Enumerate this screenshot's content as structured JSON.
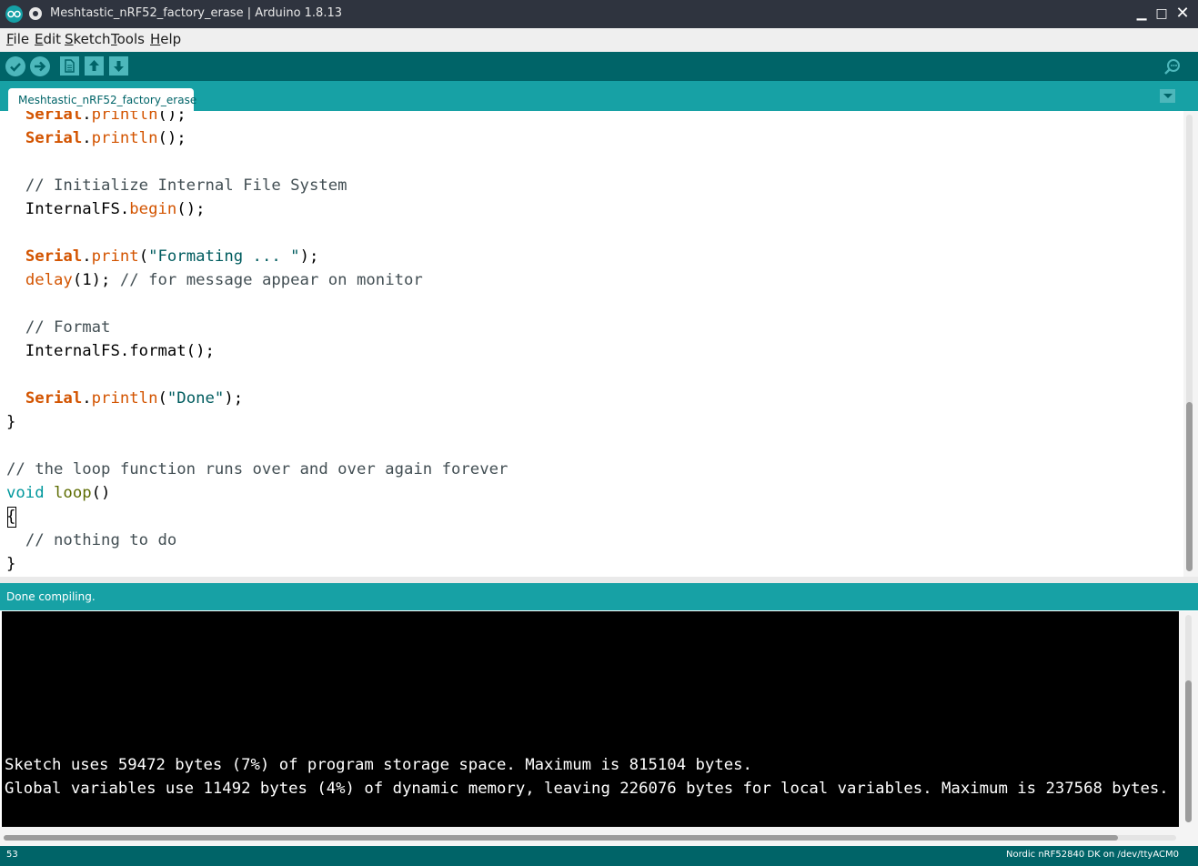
{
  "window": {
    "title": "Meshtastic_nRF52_factory_erase | Arduino 1.8.13",
    "minimize_label": "▁",
    "maximize_label": "□",
    "close_label": "✕"
  },
  "menu": [
    {
      "acc": "F",
      "rest": "ile"
    },
    {
      "acc": "E",
      "rest": "dit"
    },
    {
      "acc": "S",
      "rest": "ketch"
    },
    {
      "acc": "T",
      "rest": "ools"
    },
    {
      "acc": "H",
      "rest": "elp"
    }
  ],
  "toolbar": {
    "icons": [
      "verify-icon",
      "upload-icon",
      "new-icon",
      "open-icon",
      "save-icon",
      "serial-monitor-icon"
    ]
  },
  "tabs": {
    "active": "Meshtastic_nRF52_factory_erase"
  },
  "colors": {
    "teal_dark": "#006468",
    "teal": "#17a1a5",
    "keyword_orange": "#d35400",
    "keyword_teal": "#00979c",
    "function_olive": "#5e6d03",
    "string": "#005c5f",
    "comment": "#434f54"
  },
  "editor": {
    "lines": [
      {
        "tokens": [
          {
            "t": "  "
          },
          {
            "t": "Serial",
            "c": "kw-orange"
          },
          {
            "t": "."
          },
          {
            "t": "println",
            "c": "fn-orange"
          },
          {
            "t": "();"
          }
        ]
      },
      {
        "tokens": [
          {
            "t": "  "
          },
          {
            "t": "Serial",
            "c": "kw-orange"
          },
          {
            "t": "."
          },
          {
            "t": "println",
            "c": "fn-orange"
          },
          {
            "t": "();"
          }
        ]
      },
      {
        "tokens": []
      },
      {
        "tokens": [
          {
            "t": "  "
          },
          {
            "t": "// Initialize Internal File System",
            "c": "cmt"
          }
        ]
      },
      {
        "tokens": [
          {
            "t": "  InternalFS."
          },
          {
            "t": "begin",
            "c": "fn-orange"
          },
          {
            "t": "();"
          }
        ]
      },
      {
        "tokens": []
      },
      {
        "tokens": [
          {
            "t": "  "
          },
          {
            "t": "Serial",
            "c": "kw-orange"
          },
          {
            "t": "."
          },
          {
            "t": "print",
            "c": "fn-orange"
          },
          {
            "t": "("
          },
          {
            "t": "\"Formating ... \"",
            "c": "str"
          },
          {
            "t": ");"
          }
        ]
      },
      {
        "tokens": [
          {
            "t": "  "
          },
          {
            "t": "delay",
            "c": "fn-orange"
          },
          {
            "t": "(1); "
          },
          {
            "t": "// for message appear on monitor",
            "c": "cmt"
          }
        ]
      },
      {
        "tokens": []
      },
      {
        "tokens": [
          {
            "t": "  "
          },
          {
            "t": "// Format",
            "c": "cmt"
          }
        ]
      },
      {
        "tokens": [
          {
            "t": "  InternalFS.format();"
          }
        ]
      },
      {
        "tokens": []
      },
      {
        "tokens": [
          {
            "t": "  "
          },
          {
            "t": "Serial",
            "c": "kw-orange"
          },
          {
            "t": "."
          },
          {
            "t": "println",
            "c": "fn-orange"
          },
          {
            "t": "("
          },
          {
            "t": "\"Done\"",
            "c": "str"
          },
          {
            "t": ");"
          }
        ]
      },
      {
        "tokens": [
          {
            "t": "}"
          }
        ]
      },
      {
        "tokens": []
      },
      {
        "tokens": [
          {
            "t": "// the loop function runs over and over again forever",
            "c": "cmt"
          }
        ]
      },
      {
        "tokens": [
          {
            "t": "void",
            "c": "kw-teal"
          },
          {
            "t": " "
          },
          {
            "t": "loop",
            "c": "fn-olive"
          },
          {
            "t": "()"
          }
        ]
      },
      {
        "tokens": [
          {
            "t": "{"
          }
        ]
      },
      {
        "tokens": [
          {
            "t": "  "
          },
          {
            "t": "// nothing to do",
            "c": "cmt"
          }
        ]
      },
      {
        "tokens": [
          {
            "t": "}"
          }
        ]
      }
    ]
  },
  "status": {
    "message": "Done compiling."
  },
  "console": {
    "lines": [
      "Sketch uses 59472 bytes (7%) of program storage space. Maximum is 815104 bytes.",
      "Global variables use 11492 bytes (4%) of dynamic memory, leaving 226076 bytes for local variables. Maximum is 237568 bytes."
    ]
  },
  "footer": {
    "line_number": "53",
    "board": "Nordic nRF52840 DK on /dev/ttyACM0"
  }
}
